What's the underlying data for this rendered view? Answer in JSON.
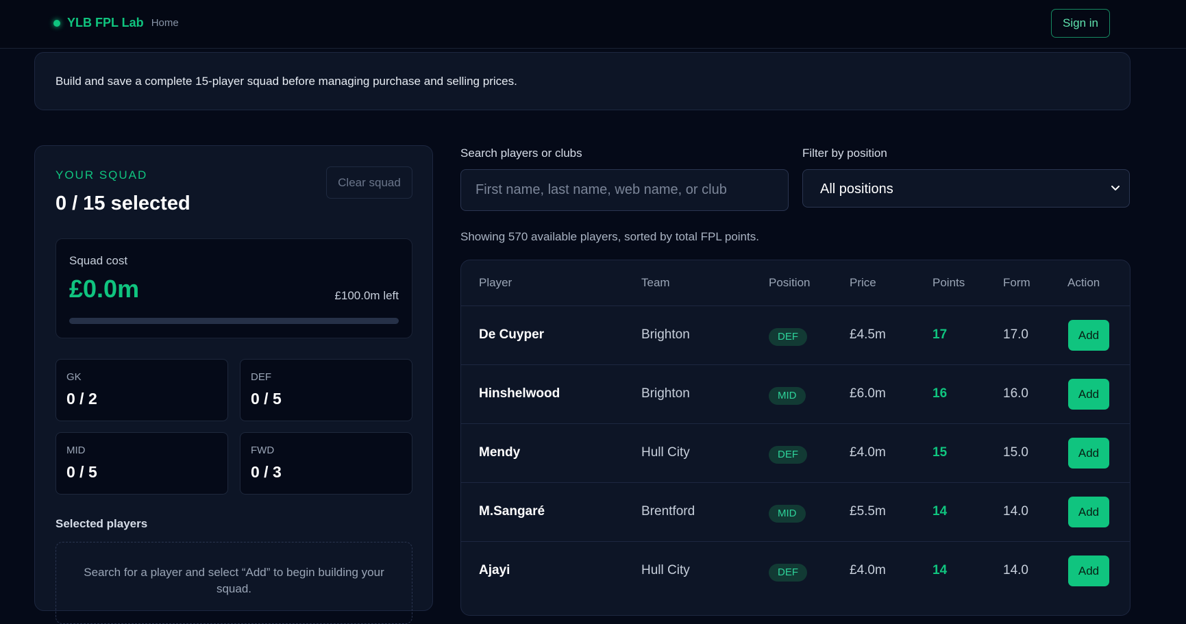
{
  "header": {
    "brand": "YLB FPL Lab",
    "home_link": "Home",
    "signin_label": "Sign in",
    "accent_color": "#10c47f"
  },
  "banner": {
    "text": "Build and save a complete 15-player squad before managing purchase and selling prices."
  },
  "squad": {
    "kicker": "YOUR SQUAD",
    "count": "0 / 15 selected",
    "clear_label": "Clear squad",
    "cost_label": "Squad cost",
    "cost_value": "£0.0m",
    "left_text": "£100.0m left",
    "budget_used_fraction": 0,
    "positions": [
      {
        "label": "GK",
        "value": "0 / 2"
      },
      {
        "label": "DEF",
        "value": "0 / 5"
      },
      {
        "label": "MID",
        "value": "0 / 5"
      },
      {
        "label": "FWD",
        "value": "0 / 3"
      }
    ],
    "selected_heading": "Selected players",
    "empty_text": "Search for a player and select “Add” to begin building your squad."
  },
  "filters": {
    "search_label": "Search players or clubs",
    "search_placeholder": "First name, last name, web name, or club",
    "position_label": "Filter by position",
    "position_value": "All positions",
    "chevron_icon": "chevron-down-icon"
  },
  "results": {
    "summary": "Showing 570 available players, sorted by total FPL points.",
    "columns": [
      "Player",
      "Team",
      "Position",
      "Price",
      "Points",
      "Form",
      "Action"
    ],
    "add_label": "Add",
    "rows": [
      {
        "name": "De Cuyper",
        "team": "Brighton",
        "position": "DEF",
        "price": "£4.5m",
        "points": "17",
        "form": "17.0"
      },
      {
        "name": "Hinshelwood",
        "team": "Brighton",
        "position": "MID",
        "price": "£6.0m",
        "points": "16",
        "form": "16.0"
      },
      {
        "name": "Mendy",
        "team": "Hull City",
        "position": "DEF",
        "price": "£4.0m",
        "points": "15",
        "form": "15.0"
      },
      {
        "name": "M.Sangaré",
        "team": "Brentford",
        "position": "MID",
        "price": "£5.5m",
        "points": "14",
        "form": "14.0"
      },
      {
        "name": "Ajayi",
        "team": "Hull City",
        "position": "DEF",
        "price": "£4.0m",
        "points": "14",
        "form": "14.0"
      }
    ]
  }
}
